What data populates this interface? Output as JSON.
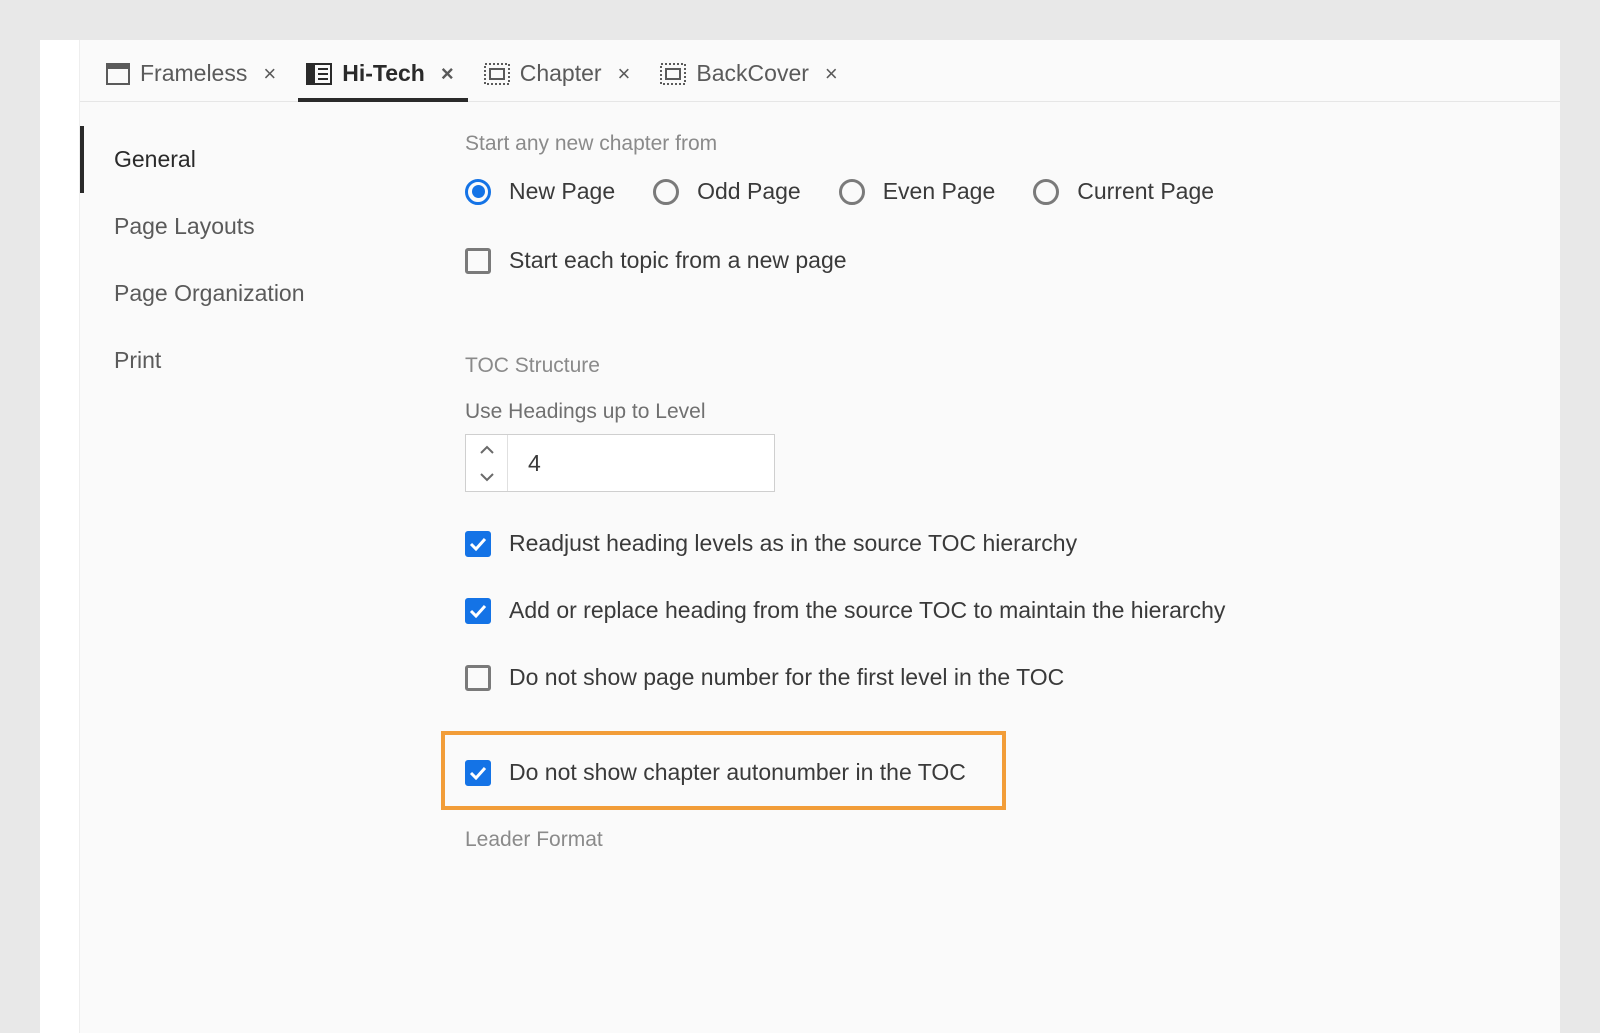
{
  "tabs": [
    {
      "label": "Frameless",
      "active": false
    },
    {
      "label": "Hi-Tech",
      "active": true
    },
    {
      "label": "Chapter",
      "active": false
    },
    {
      "label": "BackCover",
      "active": false
    }
  ],
  "sidebar": [
    {
      "label": "General",
      "active": true
    },
    {
      "label": "Page Layouts",
      "active": false
    },
    {
      "label": "Page Organization",
      "active": false
    },
    {
      "label": "Print",
      "active": false
    }
  ],
  "chapter_from": {
    "label": "Start any new chapter from",
    "options": [
      {
        "label": "New Page",
        "selected": true
      },
      {
        "label": "Odd Page",
        "selected": false
      },
      {
        "label": "Even Page",
        "selected": false
      },
      {
        "label": "Current Page",
        "selected": false
      }
    ]
  },
  "start_each_topic": {
    "label": "Start each topic from a new page",
    "checked": false
  },
  "toc": {
    "section_label": "TOC Structure",
    "level_label": "Use Headings up to Level",
    "level_value": "4",
    "readjust": {
      "label": "Readjust heading levels as in the source TOC hierarchy",
      "checked": true
    },
    "add_replace": {
      "label": "Add or replace heading from the source TOC to maintain the hierarchy",
      "checked": true
    },
    "hide_pgnum": {
      "label": "Do not show page number for the first level in the TOC",
      "checked": false
    },
    "hide_autonum": {
      "label": "Do not show chapter autonumber in the TOC",
      "checked": true
    }
  },
  "leader_label": "Leader Format"
}
